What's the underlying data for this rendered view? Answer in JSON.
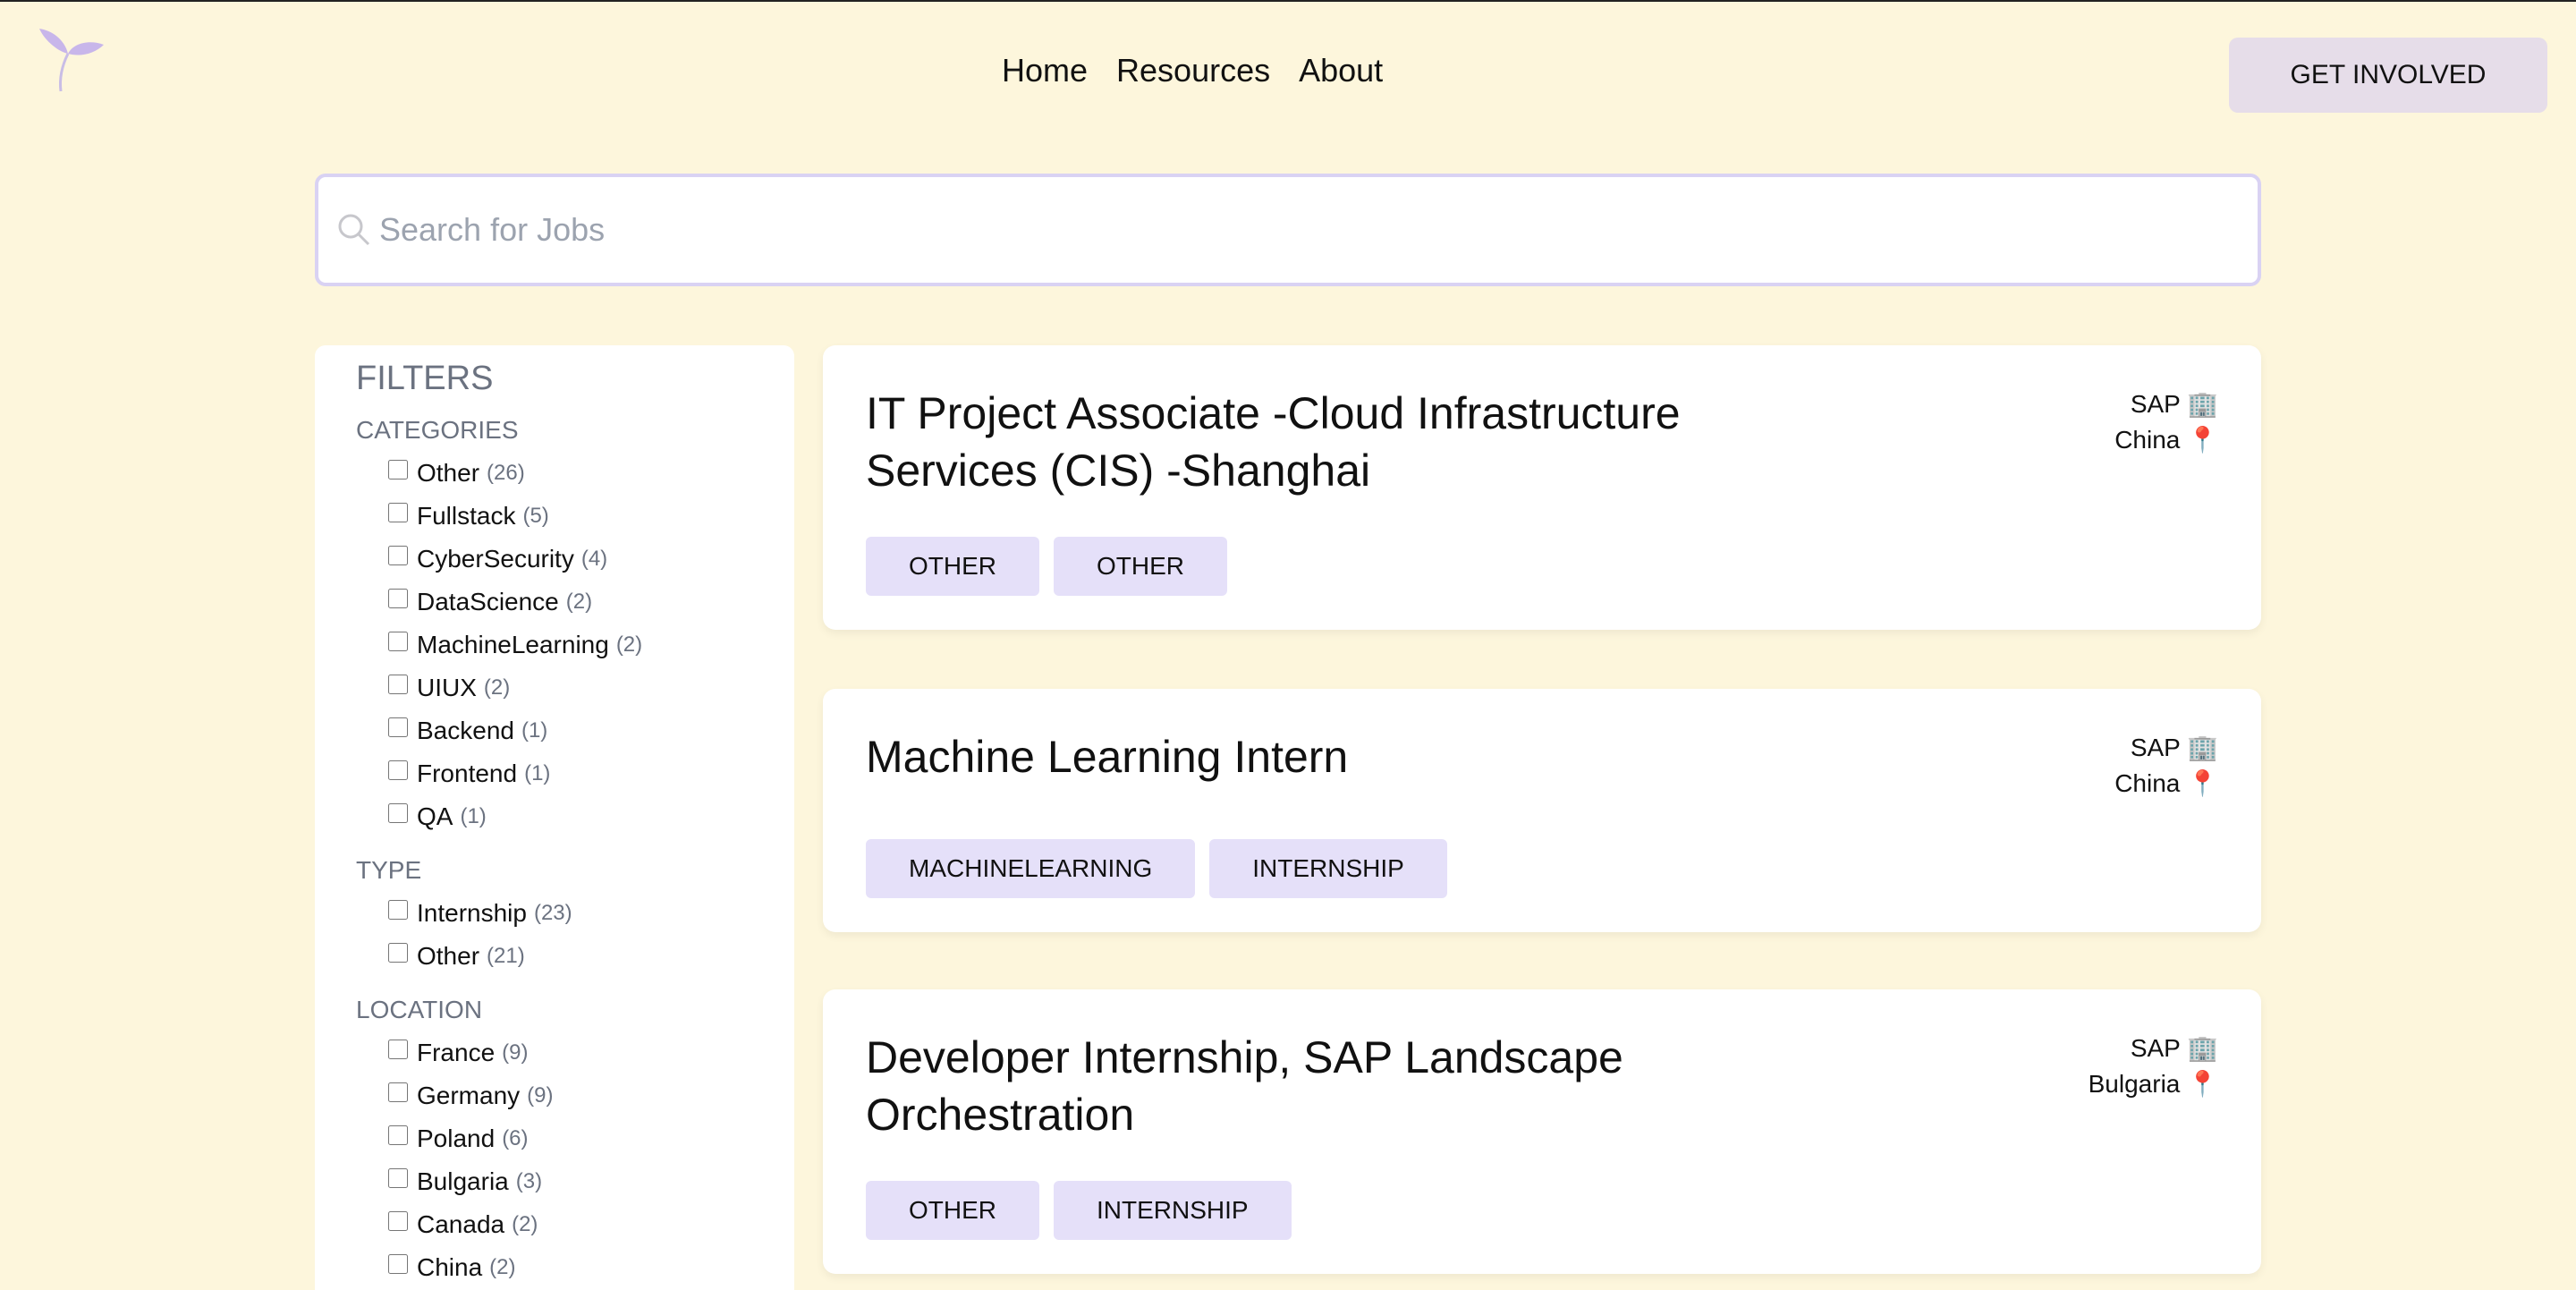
{
  "nav": {
    "home": "Home",
    "resources": "Resources",
    "about": "About"
  },
  "cta_label": "GET INVOLVED",
  "search": {
    "placeholder": "Search for Jobs"
  },
  "filters": {
    "title": "FILTERS",
    "categories_label": "CATEGORIES",
    "categories": [
      {
        "label": "Other",
        "count": "(26)"
      },
      {
        "label": "Fullstack",
        "count": "(5)"
      },
      {
        "label": "CyberSecurity",
        "count": "(4)"
      },
      {
        "label": "DataScience",
        "count": "(2)"
      },
      {
        "label": "MachineLearning",
        "count": "(2)"
      },
      {
        "label": "UIUX",
        "count": "(2)"
      },
      {
        "label": "Backend",
        "count": "(1)"
      },
      {
        "label": "Frontend",
        "count": "(1)"
      },
      {
        "label": "QA",
        "count": "(1)"
      }
    ],
    "type_label": "TYPE",
    "types": [
      {
        "label": "Internship",
        "count": "(23)"
      },
      {
        "label": "Other",
        "count": "(21)"
      }
    ],
    "location_label": "LOCATION",
    "locations": [
      {
        "label": "France",
        "count": "(9)"
      },
      {
        "label": "Germany",
        "count": "(9)"
      },
      {
        "label": "Poland",
        "count": "(6)"
      },
      {
        "label": "Bulgaria",
        "count": "(3)"
      },
      {
        "label": "Canada",
        "count": "(2)"
      },
      {
        "label": "China",
        "count": "(2)"
      }
    ]
  },
  "jobs": [
    {
      "title": "IT Project Associate -Cloud Infrastructure Services (CIS) -Shanghai",
      "company": "SAP 🏢",
      "location": "China 📍",
      "tags": [
        "OTHER",
        "OTHER"
      ]
    },
    {
      "title": "Machine Learning Intern",
      "company": "SAP 🏢",
      "location": "China 📍",
      "tags": [
        "MACHINELEARNING",
        "INTERNSHIP"
      ]
    },
    {
      "title": "Developer Internship, SAP Landscape Orchestration",
      "company": "SAP 🏢",
      "location": "Bulgaria 📍",
      "tags": [
        "OTHER",
        "INTERNSHIP"
      ]
    }
  ]
}
